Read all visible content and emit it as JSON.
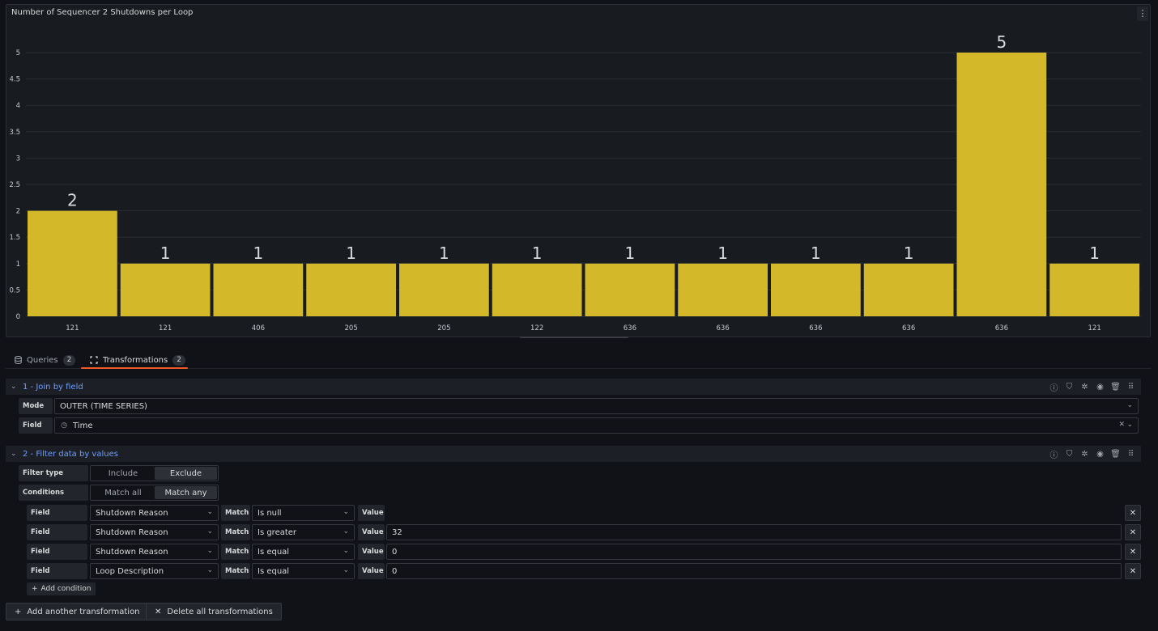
{
  "panel": {
    "title": "Number of Sequencer 2 Shutdowns per Loop",
    "menu_icon": "kebab-menu-icon"
  },
  "chart_data": {
    "type": "bar",
    "title": "Number of Sequencer 2 Shutdowns per Loop",
    "categories": [
      "121",
      "121",
      "406",
      "205",
      "205",
      "122",
      "636",
      "636",
      "636",
      "636",
      "636",
      "121"
    ],
    "values": [
      2,
      1,
      1,
      1,
      1,
      1,
      1,
      1,
      1,
      1,
      5,
      1
    ],
    "yticks": [
      "0",
      "0.5",
      "1",
      "1.5",
      "2",
      "2.5",
      "3",
      "3.5",
      "4",
      "4.5",
      "5"
    ],
    "ylim": [
      0,
      5
    ],
    "bar_color": "#d3b929",
    "grid": true,
    "show_value_labels": true
  },
  "tabs": {
    "queries": {
      "label": "Queries",
      "count": "2"
    },
    "transformations": {
      "label": "Transformations",
      "count": "2"
    },
    "accent": "#f05a28"
  },
  "transform1": {
    "title": "1 - Join by field",
    "mode_label": "Mode",
    "mode_value": "OUTER (TIME SERIES)",
    "field_label": "Field",
    "field_value": "Time"
  },
  "transform2": {
    "title": "2 - Filter data by values",
    "filter_type_label": "Filter type",
    "filter_type_options": [
      "Include",
      "Exclude"
    ],
    "conditions_label": "Conditions",
    "conditions_options": [
      "Match all",
      "Match any"
    ],
    "field_label": "Field",
    "match_label": "Match",
    "value_label": "Value",
    "conditions": [
      {
        "field": "Shutdown Reason",
        "match": "Is null",
        "value": ""
      },
      {
        "field": "Shutdown Reason",
        "match": "Is greater",
        "value": "32"
      },
      {
        "field": "Shutdown Reason",
        "match": "Is equal",
        "value": "0"
      },
      {
        "field": "Loop Description",
        "match": "Is equal",
        "value": "0"
      }
    ],
    "add_condition": "Add condition"
  },
  "footer": {
    "add_transformation": "Add another transformation",
    "delete_all": "Delete all transformations"
  },
  "colors": {
    "link_blue": "#6e9fff",
    "background": "#111217",
    "panel": "#181b1f"
  }
}
